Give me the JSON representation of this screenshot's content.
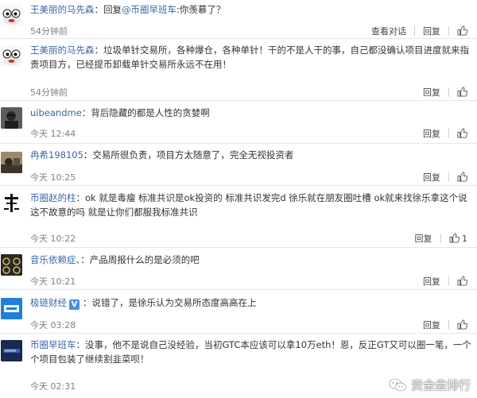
{
  "labels": {
    "reply": "回复",
    "view_conversation": "查看对话"
  },
  "comments": [
    {
      "user": "王美丽的马先森",
      "sep": "：",
      "reply_prefix": "回复",
      "mention": "@币圈早班车",
      "text_after": ":你羡慕了？",
      "time": "54分钟前",
      "likes": ""
    },
    {
      "user": "王美丽的马先森",
      "sep": "：",
      "text": "垃圾单针交易所，各种爆仓，各种单针！干的不是人干的事，自己都没确认项目进度就来指责项目方，已经提币卸载单针交易所永远不在用！",
      "time": "54分钟前",
      "likes": ""
    },
    {
      "user": "uibeandme",
      "sep": "：",
      "text": "背后隐藏的都是人性的贪婪啊",
      "time": "今天 12:44",
      "likes": ""
    },
    {
      "user": "冉希198105",
      "sep": "：",
      "text": "交易所很负责，项目方太随意了，完全无视投资者",
      "time": "今天 10:25",
      "likes": ""
    },
    {
      "user": "币圈赵的柱",
      "sep": "：",
      "text": "ok 就是毒瘤 标准共识是ok投资的 标准共识发完d 徐乐就在朋友圈吐槽 ok就来找徐乐拿这个说 这不故意的吗 就是让你们都服我标准共识",
      "time": "今天 10:22",
      "likes": "1"
    },
    {
      "user": "音乐依赖症、",
      "sep": "：",
      "text": "产品周报什么的是必须的吧",
      "time": "今天 10:21",
      "likes": ""
    },
    {
      "user": "极链财经",
      "badge": "V",
      "sep": "：",
      "text": "说错了，是徐乐认为交易所态度高高在上",
      "time": "今天 03:28",
      "likes": ""
    },
    {
      "user": "币圈早班车",
      "sep": "：",
      "text": "没事，他不是说自己没经验，当初GTC本应该可以拿10万eth！恩，反正GT又可以圈一笔，一个个项目包装了继续割韭菜呗！",
      "time": "今天 02:31",
      "likes": ""
    }
  ],
  "watermark": "资金盘排行",
  "colors": {
    "link": "#3a66a7",
    "time": "#808080",
    "divider": "#e6e6e6"
  }
}
